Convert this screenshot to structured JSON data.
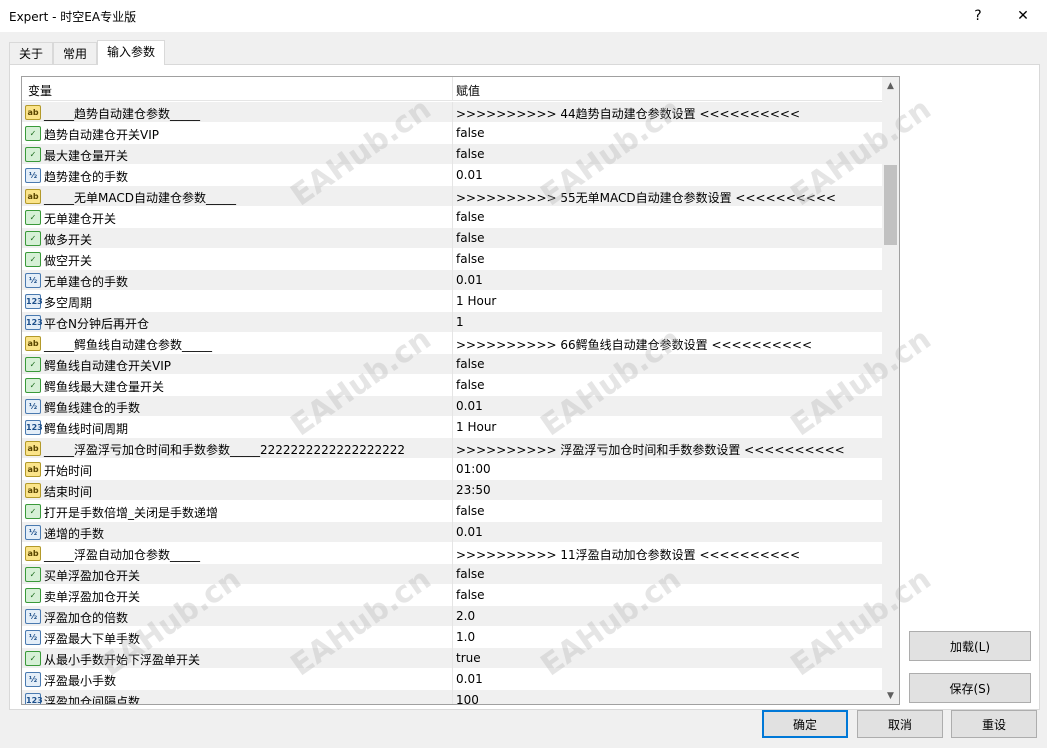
{
  "window": {
    "title": "Expert - 时空EA专业版",
    "help_label": "?",
    "close_label": "✕"
  },
  "tabs": [
    {
      "label": "关于"
    },
    {
      "label": "常用"
    },
    {
      "label": "输入参数"
    }
  ],
  "grid": {
    "col_name": "变量",
    "col_value": "赋值",
    "rows": [
      {
        "type": "ab",
        "name": "_____趋势自动建仓参数_____",
        "value": ">>>>>>>>>> 44趋势自动建仓参数设置 <<<<<<<<<<"
      },
      {
        "type": "bool",
        "name": "趋势自动建仓开关VIP",
        "value": "false"
      },
      {
        "type": "bool",
        "name": "最大建仓量开关",
        "value": "false"
      },
      {
        "type": "dbl",
        "name": "趋势建仓的手数",
        "value": "0.01"
      },
      {
        "type": "ab",
        "name": "_____无单MACD自动建仓参数_____",
        "value": ">>>>>>>>>> 55无单MACD自动建仓参数设置 <<<<<<<<<<"
      },
      {
        "type": "bool",
        "name": "无单建仓开关",
        "value": "false"
      },
      {
        "type": "bool",
        "name": "做多开关",
        "value": "false"
      },
      {
        "type": "bool",
        "name": "做空开关",
        "value": "false"
      },
      {
        "type": "dbl",
        "name": "无单建仓的手数",
        "value": "0.01"
      },
      {
        "type": "int",
        "name": "多空周期",
        "value": "1 Hour"
      },
      {
        "type": "int",
        "name": "平仓N分钟后再开仓",
        "value": "1"
      },
      {
        "type": "ab",
        "name": "_____鳄鱼线自动建仓参数_____",
        "value": ">>>>>>>>>> 66鳄鱼线自动建仓参数设置 <<<<<<<<<<"
      },
      {
        "type": "bool",
        "name": "鳄鱼线自动建仓开关VIP",
        "value": "false"
      },
      {
        "type": "bool",
        "name": "鳄鱼线最大建仓量开关",
        "value": "false"
      },
      {
        "type": "dbl",
        "name": "鳄鱼线建仓的手数",
        "value": "0.01"
      },
      {
        "type": "int",
        "name": "鳄鱼线时间周期",
        "value": "1 Hour"
      },
      {
        "type": "ab",
        "name": "_____浮盈浮亏加仓时间和手数参数_____2222222222222222222",
        "value": ">>>>>>>>>> 浮盈浮亏加仓时间和手数参数设置 <<<<<<<<<<"
      },
      {
        "type": "ab",
        "name": "开始时间",
        "value": "01:00"
      },
      {
        "type": "ab",
        "name": "结束时间",
        "value": "23:50"
      },
      {
        "type": "bool",
        "name": "打开是手数倍增_关闭是手数递增",
        "value": "false"
      },
      {
        "type": "dbl",
        "name": "递增的手数",
        "value": "0.01"
      },
      {
        "type": "ab",
        "name": "_____浮盈自动加仓参数_____",
        "value": ">>>>>>>>>> 11浮盈自动加仓参数设置 <<<<<<<<<<"
      },
      {
        "type": "bool",
        "name": "买单浮盈加仓开关",
        "value": "false"
      },
      {
        "type": "bool",
        "name": "卖单浮盈加仓开关",
        "value": "false"
      },
      {
        "type": "dbl",
        "name": "浮盈加仓的倍数",
        "value": "2.0"
      },
      {
        "type": "dbl",
        "name": "浮盈最大下单手数",
        "value": "1.0"
      },
      {
        "type": "bool",
        "name": "从最小手数开始下浮盈单开关",
        "value": "true"
      },
      {
        "type": "dbl",
        "name": "浮盈最小手数",
        "value": "0.01"
      },
      {
        "type": "int",
        "name": "浮盈加仓间隔点数",
        "value": "100"
      }
    ]
  },
  "icons": {
    "ab": "ab",
    "bool": "✓",
    "dbl": "½",
    "int": "123"
  },
  "side_buttons": {
    "load": "加载(L)",
    "save": "保存(S)"
  },
  "bottom_buttons": {
    "ok": "确定",
    "cancel": "取消",
    "reset": "重设"
  },
  "watermark": "EAHub.cn"
}
